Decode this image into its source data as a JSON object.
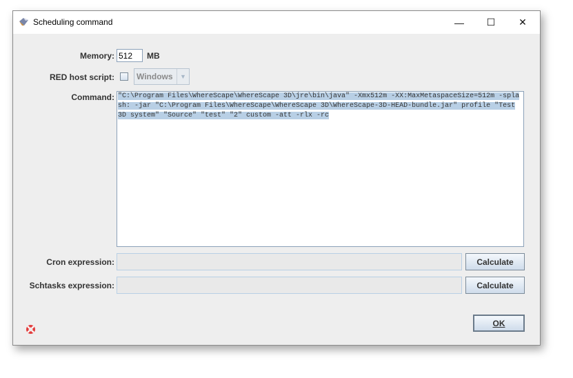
{
  "window": {
    "title": "Scheduling command",
    "minimize": "—",
    "maximize": "☐",
    "close": "✕"
  },
  "form": {
    "memory_label": "Memory:",
    "memory_value": "512",
    "memory_unit": "MB",
    "red_host_label": "RED host script:",
    "red_host_checked": false,
    "os_select": "Windows",
    "command_label": "Command:",
    "command_value": "\"C:\\Program Files\\WhereScape\\WhereScape 3D\\jre\\bin\\java\" -Xmx512m -XX:MaxMetaspaceSize=512m -splash: -jar \"C:\\Program Files\\WhereScape\\WhereScape 3D\\WhereScape-3D-HEAD-bundle.jar\" profile \"Test 3D system\" \"Source\" \"test\" \"2\" custom -att -rlx -rc ",
    "cron_label": "Cron expression:",
    "cron_value": "",
    "cron_button": "Calculate",
    "schtasks_label": "Schtasks expression:",
    "schtasks_value": "",
    "schtasks_button": "Calculate"
  },
  "footer": {
    "ok_label": "OK",
    "help_icon": "lifebuoy-icon"
  }
}
